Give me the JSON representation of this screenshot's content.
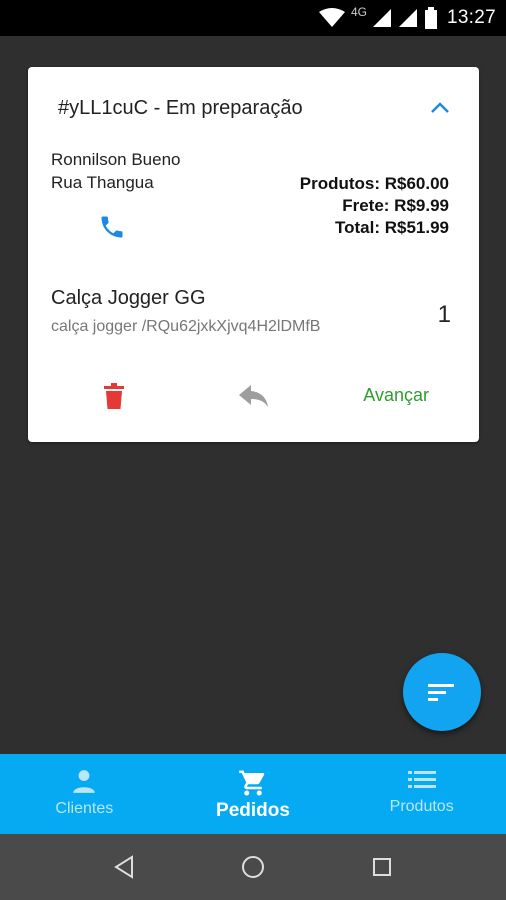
{
  "status_bar": {
    "network": "4G",
    "time": "13:27"
  },
  "order": {
    "title": "#yLL1cuC - Em preparação",
    "customer_name": "Ronnilson Bueno",
    "customer_address": "Rua Thangua",
    "products_total": "Produtos: R$60.00",
    "shipping": "Frete: R$9.99",
    "total": "Total: R$51.99",
    "item_name": "Calça Jogger  GG",
    "item_description": "calça jogger /RQu62jxkXjvq4H2lDMfB",
    "item_quantity": "1",
    "advance_label": "Avançar"
  },
  "bottom_nav": {
    "items": [
      {
        "label": "Clientes",
        "icon": "person-icon",
        "active": false
      },
      {
        "label": "Pedidos",
        "icon": "cart-icon",
        "active": true
      },
      {
        "label": "Produtos",
        "icon": "list-icon",
        "active": false
      }
    ]
  },
  "colors": {
    "accent": "#06aaf3",
    "fab": "#12a4f0",
    "delete": "#e53935",
    "advance": "#2e9e2e",
    "phone": "#1e88e5"
  }
}
